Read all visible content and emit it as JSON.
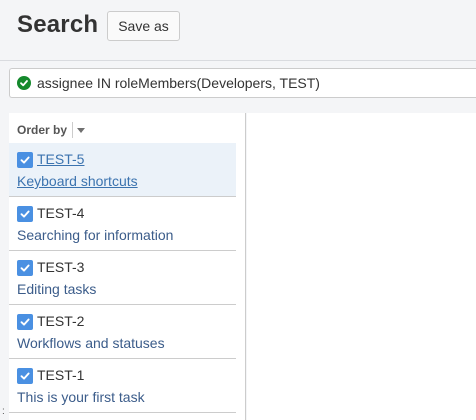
{
  "header": {
    "title": "Search",
    "save_as_label": "Save as"
  },
  "search": {
    "status": "valid",
    "query": "assignee IN roleMembers(Developers, TEST)"
  },
  "list": {
    "order_by_label": "Order by",
    "issues": [
      {
        "key": "TEST-5",
        "summary": "Keyboard shortcuts",
        "selected": true
      },
      {
        "key": "TEST-4",
        "summary": "Searching for information",
        "selected": false
      },
      {
        "key": "TEST-3",
        "summary": "Editing tasks",
        "selected": false
      },
      {
        "key": "TEST-2",
        "summary": "Workflows and statuses",
        "selected": false
      },
      {
        "key": "TEST-1",
        "summary": "This is your first task",
        "selected": false
      }
    ]
  },
  "edge_mark": ":",
  "colors": {
    "accent": "#3b73af",
    "selected_bg": "#ebf2f9",
    "task_icon": "#4a90e2",
    "valid_status": "#14892c"
  },
  "icons": {
    "valid": "check-circle-icon",
    "issue_type": "task-icon",
    "order_menu": "chevron-down-icon"
  }
}
